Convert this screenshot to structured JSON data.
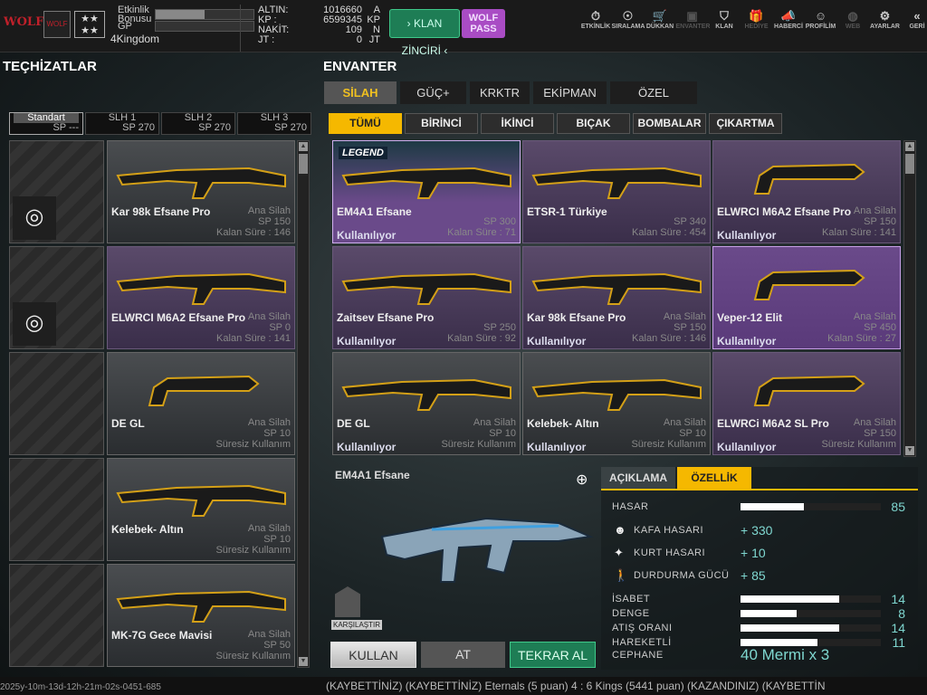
{
  "topbar": {
    "logo_text": "WOLF",
    "clan_text": "WOLF",
    "rank_stars": "★★ ★★",
    "event_bonus_label": "Etkinlik Bonusu",
    "event_bonus_progress": 0.5,
    "gp_label": "GP",
    "gp_progress": 0,
    "username": "4Kingdom",
    "currencies": [
      {
        "label": "ALTIN:",
        "value": "1016660",
        "unit": "A"
      },
      {
        "label": "KP :",
        "value": "6599345",
        "unit": "KP"
      },
      {
        "label": "NAKİT:",
        "value": "109",
        "unit": "N"
      },
      {
        "label": "JT :",
        "value": "0",
        "unit": "JT"
      }
    ],
    "klan_button": "› KLAN ZİNCİRİ ‹",
    "wolf_pass_button": "WOLF PASS",
    "nav": [
      {
        "label": "ETKİNLİK",
        "icon": "timer-icon",
        "glyph": "⏱"
      },
      {
        "label": "SIRALAMA",
        "icon": "medal-icon",
        "glyph": "☉"
      },
      {
        "label": "DÜKKAN",
        "icon": "cart-icon",
        "glyph": "🛒"
      },
      {
        "label": "ENVANTER",
        "icon": "inventory-icon",
        "glyph": "▣",
        "dim": true
      },
      {
        "label": "KLAN",
        "icon": "shield-icon",
        "glyph": "⛉"
      },
      {
        "label": "HEDİYE",
        "icon": "gift-icon",
        "glyph": "🎁",
        "dim": true
      },
      {
        "label": "HABERCİ",
        "icon": "megaphone-icon",
        "glyph": "📣"
      },
      {
        "label": "PROFİLİM",
        "icon": "profile-icon",
        "glyph": "☺"
      },
      {
        "label": "WEB",
        "icon": "globe-icon",
        "glyph": "◍",
        "dim": true
      },
      {
        "label": "AYARLAR",
        "icon": "gear-icon",
        "glyph": "⚙"
      },
      {
        "label": "GERİ",
        "icon": "back-icon",
        "glyph": "«"
      }
    ]
  },
  "equipment": {
    "title": "TEÇHİZATLAR",
    "slots": [
      {
        "name": "Standart",
        "sp": "SP ---"
      },
      {
        "name": "SLH 1",
        "sp": "SP 270"
      },
      {
        "name": "SLH 2",
        "sp": "SP 270"
      },
      {
        "name": "SLH 3",
        "sp": "SP 270"
      }
    ],
    "items": [
      {
        "name": "Kar 98k Efsane Pro",
        "type": "Ana Silah",
        "sp": "SP 150",
        "time": "Kalan Süre : 146",
        "swap": true,
        "style": ""
      },
      {
        "name": "ELWRCI M6A2 Efsane Pro",
        "type": "Ana Silah",
        "sp": "SP 0",
        "time": "Kalan Süre : 141",
        "swap": true,
        "style": "purple"
      },
      {
        "name": "DE GL",
        "type": "Ana Silah",
        "sp": "SP 10",
        "time": "Süresiz Kullanım",
        "swap": false,
        "style": ""
      },
      {
        "name": "Kelebek- Altın",
        "type": "Ana Silah",
        "sp": "SP 10",
        "time": "Süresiz Kullanım",
        "swap": false,
        "style": ""
      },
      {
        "name": "MK-7G Gece Mavisi",
        "type": "Ana Silah",
        "sp": "SP 50",
        "time": "Süresiz Kullanım",
        "swap": false,
        "style": ""
      }
    ]
  },
  "inventory": {
    "title": "ENVANTER",
    "tabs": [
      "SİLAH",
      "GÜÇ+",
      "KRKTR",
      "EKİPMAN",
      "ÖZEL"
    ],
    "subtabs": [
      "TÜMÜ",
      "BİRİNCİ",
      "İKİNCİ",
      "BIÇAK",
      "BOMBALAR",
      "ÇIKARTMA"
    ],
    "items": [
      {
        "name": "EM4A1 Efsane",
        "type": "",
        "sp": "SP 300",
        "time": "Kalan Süre : 71",
        "status": "Kullanılıyor",
        "style": "leg",
        "badge": "LEGEND"
      },
      {
        "name": "ETSR-1 Türkiye",
        "type": "",
        "sp": "SP 340",
        "time": "Kalan Süre : 454",
        "status": "",
        "style": "purple"
      },
      {
        "name": "ELWRCI M6A2 Efsane Pro",
        "type": "Ana Silah",
        "sp": "SP 150",
        "time": "Kalan Süre : 141",
        "status": "Kullanılıyor",
        "style": "purple"
      },
      {
        "name": "Zaitsev Efsane Pro",
        "type": "",
        "sp": "SP 250",
        "time": "Kalan Süre : 92",
        "status": "Kullanılıyor",
        "style": "purple"
      },
      {
        "name": "Kar 98k Efsane Pro",
        "type": "Ana Silah",
        "sp": "SP 150",
        "time": "Kalan Süre : 146",
        "status": "Kullanılıyor",
        "style": "purple"
      },
      {
        "name": "Veper-12 Elit",
        "type": "Ana Silah",
        "sp": "SP 450",
        "time": "Kalan Süre : 27",
        "status": "Kullanılıyor",
        "style": "sel"
      },
      {
        "name": "DE GL",
        "type": "Ana Silah",
        "sp": "SP 10",
        "time": "Süresiz Kullanım",
        "status": "Kullanılıyor",
        "style": ""
      },
      {
        "name": "Kelebek- Altın",
        "type": "Ana Silah",
        "sp": "SP 10",
        "time": "Süresiz Kullanım",
        "status": "Kullanılıyor",
        "style": ""
      },
      {
        "name": "ELWRCi M6A2 SL Pro",
        "type": "Ana Silah",
        "sp": "SP 150",
        "time": "Süresiz Kullanım",
        "status": "Kullanılıyor",
        "style": "purple"
      }
    ]
  },
  "detail": {
    "name": "EM4A1 Efsane",
    "compare": "KARŞILAŞTIR",
    "tabs": [
      "AÇIKLAMA",
      "ÖZELLİK"
    ],
    "stats": [
      {
        "label": "HASAR",
        "value": "85",
        "fill": 0.45
      },
      {
        "label": "İSABET",
        "value": "14",
        "fill": 0.7
      },
      {
        "label": "DENGE",
        "value": "8",
        "fill": 0.4
      },
      {
        "label": "ATIŞ ORANI",
        "value": "14",
        "fill": 0.7
      },
      {
        "label": "HAREKETLİ",
        "value": "11",
        "fill": 0.55
      }
    ],
    "bonuses": [
      {
        "label": "KAFA HASARI",
        "value": "+ 330",
        "icon": "head-icon"
      },
      {
        "label": "KURT HASARI",
        "value": "+ 10",
        "icon": "wolf-icon"
      },
      {
        "label": "DURDURMA GÜCÜ",
        "value": "+ 85",
        "icon": "stopping-power-icon"
      }
    ],
    "ammo_label": "CEPHANE",
    "ammo_value": "40 Mermi x 3"
  },
  "actions": {
    "use": "KULLAN",
    "drop": "AT",
    "rebuy": "TEKRAR AL"
  },
  "ticker": "(KAYBETTİNİZ)      (KAYBETTİNİZ) Eternals (5 puan) 4 : 6 Kings (5441 puan) (KAZANDINIZ)      (KAYBETTİN",
  "watermark_timestamp": "2025y-10m-13d-12h-21m-02s-0451-685"
}
